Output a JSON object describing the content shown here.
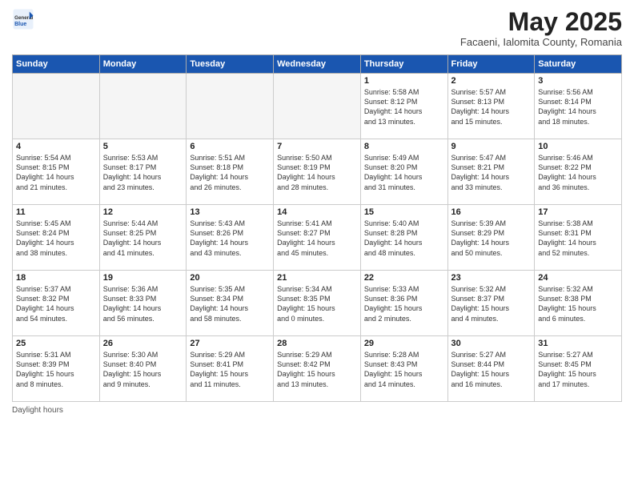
{
  "logo": {
    "general": "General",
    "blue": "Blue"
  },
  "title": "May 2025",
  "location": "Facaeni, Ialomita County, Romania",
  "days_of_week": [
    "Sunday",
    "Monday",
    "Tuesday",
    "Wednesday",
    "Thursday",
    "Friday",
    "Saturday"
  ],
  "weeks": [
    [
      {
        "day": "",
        "content": ""
      },
      {
        "day": "",
        "content": ""
      },
      {
        "day": "",
        "content": ""
      },
      {
        "day": "",
        "content": ""
      },
      {
        "day": "1",
        "content": "Sunrise: 5:58 AM\nSunset: 8:12 PM\nDaylight: 14 hours\nand 13 minutes."
      },
      {
        "day": "2",
        "content": "Sunrise: 5:57 AM\nSunset: 8:13 PM\nDaylight: 14 hours\nand 15 minutes."
      },
      {
        "day": "3",
        "content": "Sunrise: 5:56 AM\nSunset: 8:14 PM\nDaylight: 14 hours\nand 18 minutes."
      }
    ],
    [
      {
        "day": "4",
        "content": "Sunrise: 5:54 AM\nSunset: 8:15 PM\nDaylight: 14 hours\nand 21 minutes."
      },
      {
        "day": "5",
        "content": "Sunrise: 5:53 AM\nSunset: 8:17 PM\nDaylight: 14 hours\nand 23 minutes."
      },
      {
        "day": "6",
        "content": "Sunrise: 5:51 AM\nSunset: 8:18 PM\nDaylight: 14 hours\nand 26 minutes."
      },
      {
        "day": "7",
        "content": "Sunrise: 5:50 AM\nSunset: 8:19 PM\nDaylight: 14 hours\nand 28 minutes."
      },
      {
        "day": "8",
        "content": "Sunrise: 5:49 AM\nSunset: 8:20 PM\nDaylight: 14 hours\nand 31 minutes."
      },
      {
        "day": "9",
        "content": "Sunrise: 5:47 AM\nSunset: 8:21 PM\nDaylight: 14 hours\nand 33 minutes."
      },
      {
        "day": "10",
        "content": "Sunrise: 5:46 AM\nSunset: 8:22 PM\nDaylight: 14 hours\nand 36 minutes."
      }
    ],
    [
      {
        "day": "11",
        "content": "Sunrise: 5:45 AM\nSunset: 8:24 PM\nDaylight: 14 hours\nand 38 minutes."
      },
      {
        "day": "12",
        "content": "Sunrise: 5:44 AM\nSunset: 8:25 PM\nDaylight: 14 hours\nand 41 minutes."
      },
      {
        "day": "13",
        "content": "Sunrise: 5:43 AM\nSunset: 8:26 PM\nDaylight: 14 hours\nand 43 minutes."
      },
      {
        "day": "14",
        "content": "Sunrise: 5:41 AM\nSunset: 8:27 PM\nDaylight: 14 hours\nand 45 minutes."
      },
      {
        "day": "15",
        "content": "Sunrise: 5:40 AM\nSunset: 8:28 PM\nDaylight: 14 hours\nand 48 minutes."
      },
      {
        "day": "16",
        "content": "Sunrise: 5:39 AM\nSunset: 8:29 PM\nDaylight: 14 hours\nand 50 minutes."
      },
      {
        "day": "17",
        "content": "Sunrise: 5:38 AM\nSunset: 8:31 PM\nDaylight: 14 hours\nand 52 minutes."
      }
    ],
    [
      {
        "day": "18",
        "content": "Sunrise: 5:37 AM\nSunset: 8:32 PM\nDaylight: 14 hours\nand 54 minutes."
      },
      {
        "day": "19",
        "content": "Sunrise: 5:36 AM\nSunset: 8:33 PM\nDaylight: 14 hours\nand 56 minutes."
      },
      {
        "day": "20",
        "content": "Sunrise: 5:35 AM\nSunset: 8:34 PM\nDaylight: 14 hours\nand 58 minutes."
      },
      {
        "day": "21",
        "content": "Sunrise: 5:34 AM\nSunset: 8:35 PM\nDaylight: 15 hours\nand 0 minutes."
      },
      {
        "day": "22",
        "content": "Sunrise: 5:33 AM\nSunset: 8:36 PM\nDaylight: 15 hours\nand 2 minutes."
      },
      {
        "day": "23",
        "content": "Sunrise: 5:32 AM\nSunset: 8:37 PM\nDaylight: 15 hours\nand 4 minutes."
      },
      {
        "day": "24",
        "content": "Sunrise: 5:32 AM\nSunset: 8:38 PM\nDaylight: 15 hours\nand 6 minutes."
      }
    ],
    [
      {
        "day": "25",
        "content": "Sunrise: 5:31 AM\nSunset: 8:39 PM\nDaylight: 15 hours\nand 8 minutes."
      },
      {
        "day": "26",
        "content": "Sunrise: 5:30 AM\nSunset: 8:40 PM\nDaylight: 15 hours\nand 9 minutes."
      },
      {
        "day": "27",
        "content": "Sunrise: 5:29 AM\nSunset: 8:41 PM\nDaylight: 15 hours\nand 11 minutes."
      },
      {
        "day": "28",
        "content": "Sunrise: 5:29 AM\nSunset: 8:42 PM\nDaylight: 15 hours\nand 13 minutes."
      },
      {
        "day": "29",
        "content": "Sunrise: 5:28 AM\nSunset: 8:43 PM\nDaylight: 15 hours\nand 14 minutes."
      },
      {
        "day": "30",
        "content": "Sunrise: 5:27 AM\nSunset: 8:44 PM\nDaylight: 15 hours\nand 16 minutes."
      },
      {
        "day": "31",
        "content": "Sunrise: 5:27 AM\nSunset: 8:45 PM\nDaylight: 15 hours\nand 17 minutes."
      }
    ]
  ],
  "footer": "Daylight hours"
}
